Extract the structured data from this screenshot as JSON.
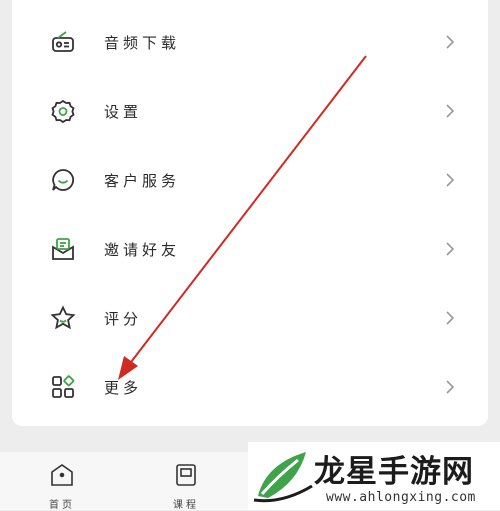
{
  "menu": {
    "items": [
      {
        "label": "音频下载",
        "icon": "radio-icon"
      },
      {
        "label": "设置",
        "icon": "gear-icon"
      },
      {
        "label": "客户服务",
        "icon": "chat-smile-icon"
      },
      {
        "label": "邀请好友",
        "icon": "envelope-invite-icon"
      },
      {
        "label": "评分",
        "icon": "star-icon"
      },
      {
        "label": "更多",
        "icon": "grid-more-icon"
      }
    ]
  },
  "tabbar": {
    "tabs": [
      {
        "label": "首页",
        "icon": "home-icon"
      },
      {
        "label": "课程",
        "icon": "book-icon"
      }
    ]
  },
  "watermark": {
    "title": "龙星手游网",
    "url": "www.ahlongxing.com"
  },
  "colors": {
    "accent_green": "#3ea34a",
    "icon_stroke": "#333333",
    "arrow_red": "#d12a22",
    "background": "#ededee"
  }
}
